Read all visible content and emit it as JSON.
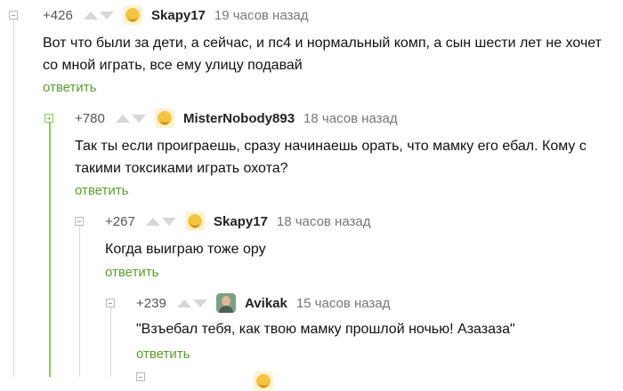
{
  "comments": [
    {
      "rating": "+426",
      "username": "Skapy17",
      "time": "19 часов назад",
      "text": "Вот что были за дети, а сейчас, и пс4 и нормальный комп, а сын шести лет не хочет\nсо мной играть, все ему улицу подавай",
      "reply": "ответить",
      "avatar": "smile-avatar-icon"
    },
    {
      "rating": "+780",
      "username": "MisterNobody893",
      "time": "18 часов назад",
      "text": "Так ты если проиграешь, сразу начинаешь орать, что мамку его ебал. Кому с\nтакими токсиками играть охота?",
      "reply": "ответить",
      "avatar": "smile-avatar-icon"
    },
    {
      "rating": "+267",
      "username": "Skapy17",
      "time": "18 часов назад",
      "text": "Когда выиграю тоже ору",
      "reply": "ответить",
      "avatar": "smile-avatar-icon"
    },
    {
      "rating": "+239",
      "username": "Avikak",
      "time": "15 часов назад",
      "text": "\"Взъебал тебя, как твою мамку прошлой ночью! Азазаза\"",
      "reply": "ответить",
      "avatar": "photo-avatar-icon"
    }
  ],
  "colors": {
    "accent": "#5a9e2f",
    "thread_active": "#8ac858",
    "vote_arrow": "#d7d7d7"
  }
}
